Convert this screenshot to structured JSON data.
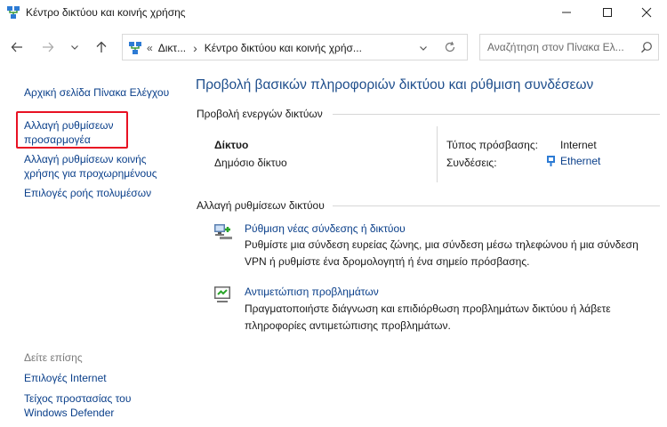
{
  "window": {
    "title": "Κέντρο δικτύου και κοινής χρήσης"
  },
  "address_bar": {
    "overflow": "«",
    "crumbs": [
      "Δικτ...",
      "Κέντρο δικτύου και κοινής χρήσ..."
    ],
    "separator": "›"
  },
  "search": {
    "placeholder": "Αναζήτηση στον Πίνακα Ελ..."
  },
  "sidebar": {
    "home_link": "Αρχική σελίδα Πίνακα Ελέγχου",
    "adapter_line1": "Αλλαγή ρυθμίσεων",
    "adapter_line2": "προσαρμογέα",
    "sharing_line1": "Αλλαγή ρυθμίσεων κοινής",
    "sharing_line2": "χρήσης για προχωρημένους",
    "media_link": "Επιλογές ροής πολυμέσων",
    "see_also_title": "Δείτε επίσης",
    "internet_options": "Επιλογές Internet",
    "firewall_line1": "Τείχος προστασίας του",
    "firewall_line2": "Windows Defender"
  },
  "main": {
    "heading": "Προβολή βασικών πληροφοριών δικτύου και ρύθμιση συνδέσεων",
    "active_networks_title": "Προβολή ενεργών δικτύων",
    "network_name": "Δίκτυο",
    "network_type": "Δημόσιο δίκτυο",
    "access_type_label": "Τύπος πρόσβασης:",
    "access_type_value": "Internet",
    "connections_label": "Συνδέσεις:",
    "connections_value": "Ethernet",
    "change_settings_title": "Αλλαγή ρυθμίσεων δικτύου",
    "setup_link": "Ρύθμιση νέας σύνδεσης ή δικτύου",
    "setup_desc_line1": "Ρυθμίστε μια σύνδεση ευρείας ζώνης, μια σύνδεση μέσω τηλεφώνου ή μια σύνδεση",
    "setup_desc_line2": "VPN ή ρυθμίστε ένα δρομολογητή ή ένα σημείο πρόσβασης.",
    "troubleshoot_link": "Αντιμετώπιση προβλημάτων",
    "troubleshoot_desc_line1": "Πραγματοποιήστε διάγνωση και επιδιόρθωση προβλημάτων δικτύου ή λάβετε",
    "troubleshoot_desc_line2": "πληροφορίες αντιμετώπισης προβλημάτων."
  },
  "icons": {
    "app": "network-center-icon",
    "back": "back-arrow-icon",
    "forward": "forward-arrow-icon",
    "recent": "chevron-down-icon",
    "up": "up-arrow-icon",
    "refresh": "refresh-icon",
    "search": "search-icon",
    "minimize": "minimize-icon",
    "maximize": "maximize-icon",
    "close": "close-icon"
  },
  "colors": {
    "link": "#0a3f8a",
    "heading": "#1e4e8c",
    "highlight": "#e81123"
  }
}
